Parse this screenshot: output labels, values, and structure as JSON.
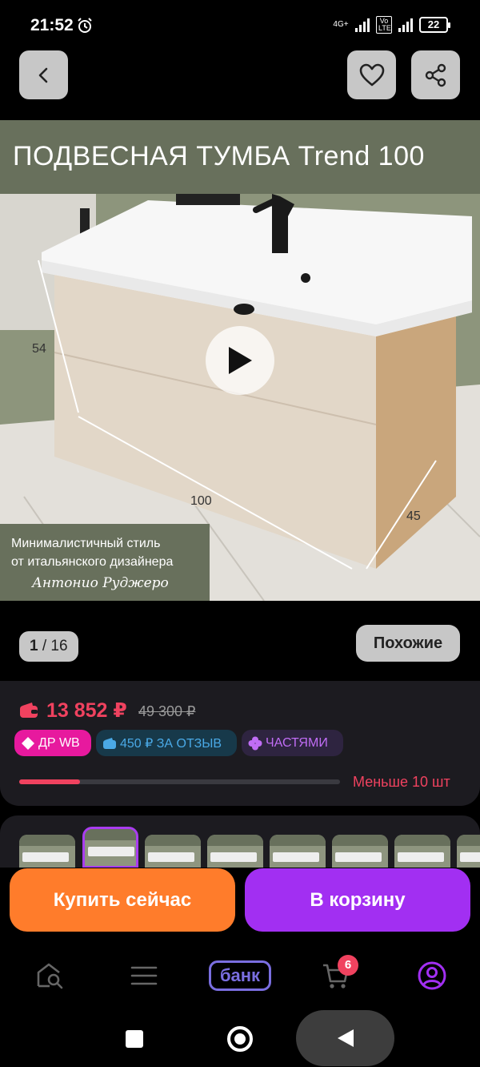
{
  "status_bar": {
    "time": "21:52",
    "network": "4G+",
    "volte": "Vo LTE",
    "battery": "22"
  },
  "gallery": {
    "banner_title": "ПОДВЕСНАЯ ТУМБА Trend 100",
    "caption_line1": "Минималистичный стиль",
    "caption_line2": "от итальянского дизайнера",
    "signature": "Антонио Руджеро",
    "dim_height": "54",
    "dim_width": "100",
    "dim_depth": "45",
    "counter_current": "1",
    "counter_total": "/ 16",
    "similar_label": "Похожие"
  },
  "product": {
    "price": "13 852 ₽",
    "old_price": "49 300 ₽",
    "badges": [
      {
        "label": "ДР WB"
      },
      {
        "label": "450 ₽ ЗА ОТЗЫВ"
      },
      {
        "label": "ЧАСТЯМИ"
      }
    ],
    "stock_text": "Меньше 10 шт",
    "stock_fraction": 0.19
  },
  "thumbnails_count": 8,
  "actions": {
    "buy_now": "Купить сейчас",
    "add_to_cart": "В корзину"
  },
  "bottom_nav": {
    "bank_label": "банк",
    "cart_count": "6"
  },
  "colors": {
    "accent_purple": "#a22ff2",
    "accent_orange": "#ff7c2b",
    "price_red": "#f0425f"
  }
}
